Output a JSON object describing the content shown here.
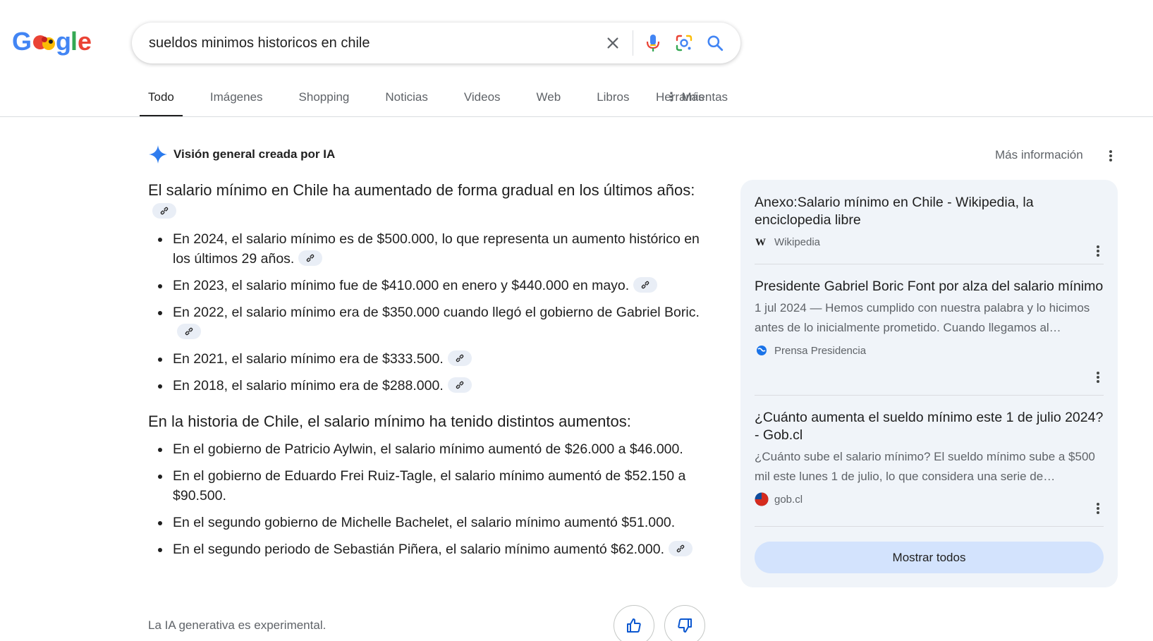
{
  "search": {
    "query": "sueldos minimos historicos en chile"
  },
  "icons": {
    "clear": "close-icon",
    "voice": "microphone-icon",
    "lens": "lens-icon",
    "search": "search-icon"
  },
  "tabs": [
    {
      "label": "Todo",
      "active": true
    },
    {
      "label": "Imágenes"
    },
    {
      "label": "Shopping"
    },
    {
      "label": "Noticias"
    },
    {
      "label": "Videos"
    },
    {
      "label": "Web"
    },
    {
      "label": "Libros"
    },
    {
      "label": "Más"
    }
  ],
  "tools_label": "Herramientas",
  "ai_overview": {
    "title": "Visión general creada por IA",
    "more_info": "Más información",
    "intro": "El salario mínimo en Chile ha aumentado de forma gradual en los últimos años:",
    "bullets1": [
      "En 2024, el salario mínimo es de $500.000, lo que representa un aumento histórico en los últimos 29 años.",
      "En 2023, el salario mínimo fue de $410.000 en enero y $440.000 en mayo.",
      "En 2022, el salario mínimo era de $350.000 cuando llegó el gobierno de Gabriel Boric.",
      "En 2021, el salario mínimo era de $333.500.",
      "En 2018, el salario mínimo era de $288.000."
    ],
    "second_para": "En la historia de Chile, el salario mínimo ha tenido distintos aumentos:",
    "bullets2": [
      "En el gobierno de Patricio Aylwin, el salario mínimo aumentó de $26.000 a $46.000.",
      "En el gobierno de Eduardo Frei Ruiz-Tagle, el salario mínimo aumentó de $52.150 a $90.500.",
      "En el segundo gobierno de Michelle Bachelet, el salario mínimo aumentó $51.000.",
      "En el segundo periodo de Sebastián Piñera, el salario mínimo aumentó $62.000."
    ],
    "disclaimer": "La IA generativa es experimental."
  },
  "sources": [
    {
      "title": "Anexo:Salario mínimo en Chile - Wikipedia, la enciclopedia libre",
      "snippet": "",
      "site": "Wikipedia",
      "favicon": "wikipedia-icon"
    },
    {
      "title": "Presidente Gabriel Boric Font por alza del salario mínimo",
      "snippet": "1 jul 2024 — Hemos cumplido con nuestra palabra y lo hicimos antes de lo inicialmente prometido. Cuando llegamos al…",
      "site": "Prensa Presidencia",
      "favicon": "globe-icon"
    },
    {
      "title": "¿Cuánto aumenta el sueldo mínimo este 1 de julio 2024? - Gob.cl",
      "snippet": "¿Cuánto sube el salario mínimo? El sueldo mínimo sube a $500 mil este lunes 1 de julio, lo que considera una serie de…",
      "site": "gob.cl",
      "favicon": "gob-cl-icon"
    }
  ],
  "show_all_label": "Mostrar todos"
}
